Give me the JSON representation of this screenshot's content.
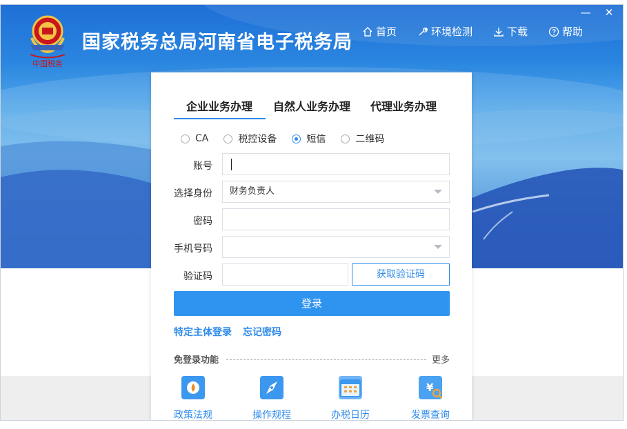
{
  "window": {
    "minimize": "—",
    "close": "✕"
  },
  "header": {
    "title": "国家税务总局河南省电子税务局",
    "logo_text": "中国税务"
  },
  "nav": [
    {
      "label": "首页",
      "icon": "home-icon"
    },
    {
      "label": "环境检测",
      "icon": "wrench-icon"
    },
    {
      "label": "下载",
      "icon": "download-icon"
    },
    {
      "label": "帮助",
      "icon": "help-icon"
    }
  ],
  "login": {
    "tabs": [
      "企业业务办理",
      "自然人业务办理",
      "代理业务办理"
    ],
    "active_tab": "企业业务办理",
    "methods": [
      {
        "label": "CA",
        "checked": false
      },
      {
        "label": "税控设备",
        "checked": false
      },
      {
        "label": "短信",
        "checked": true
      },
      {
        "label": "二维码",
        "checked": false
      }
    ],
    "fields": {
      "account_label": "账号",
      "account_value": "",
      "identity_label": "选择身份",
      "identity_value": "财务负责人",
      "password_label": "密码",
      "password_value": "",
      "phone_label": "手机号码",
      "phone_value": "",
      "code_label": "验证码",
      "code_value": ""
    },
    "get_code_button": "获取验证码",
    "login_button": "登录",
    "links": [
      "特定主体登录",
      "忘记密码"
    ],
    "free_label": "免登录功能",
    "more": "更多",
    "quick": [
      {
        "label": "政策法规",
        "icon": "policy-icon"
      },
      {
        "label": "操作规程",
        "icon": "compass-icon"
      },
      {
        "label": "办税日历",
        "icon": "calendar-icon"
      },
      {
        "label": "发票查询",
        "icon": "invoice-search-icon"
      }
    ]
  },
  "colors": {
    "accent": "#2f8bea",
    "button": "#2f93f0",
    "hero_top": "#1f6fd6",
    "hero_bottom": "#1d49a8"
  }
}
